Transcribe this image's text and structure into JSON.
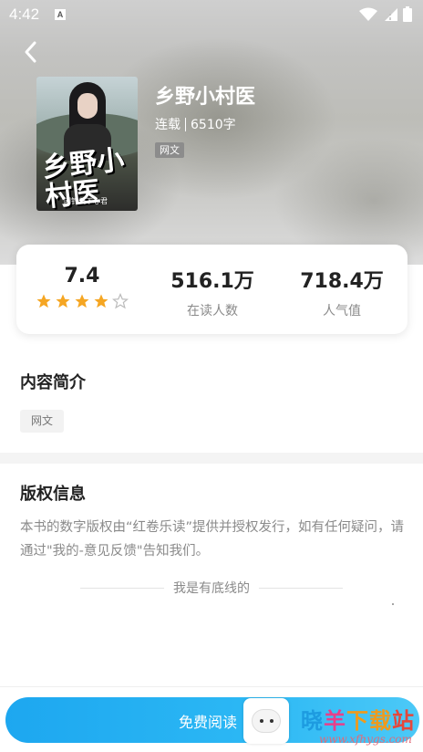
{
  "status_bar": {
    "time": "4:42",
    "notification_badge": "A",
    "icons": [
      "wifi-icon",
      "signal-icon",
      "battery-icon"
    ]
  },
  "header": {
    "back_icon": "chevron-left-icon"
  },
  "book": {
    "cover_title": "乡野小村医",
    "cover_author": "闲钓天下心君",
    "title": "乡野小村医",
    "status": "连载",
    "word_count": "6510字",
    "tag": "网文"
  },
  "stats": {
    "rating": "7.4",
    "rating_stars": 4,
    "rating_max": 5,
    "readers_value": "516.1万",
    "readers_label": "在读人数",
    "popularity_value": "718.4万",
    "popularity_label": "人气值"
  },
  "intro": {
    "title": "内容简介",
    "genre": "网文"
  },
  "copyright": {
    "title": "版权信息",
    "text": "本书的数字版权由“红卷乐读”提供并授权发行，如有任何疑问，请通过\"我的-意见反馈\"告知我们。"
  },
  "footer_note": "我是有底线的",
  "action": {
    "read_label": "免费阅读"
  },
  "watermark": {
    "c1": "晓",
    "c2": "羊",
    "c3": "下载",
    "c4": "站",
    "url": "www.xfhygs.com"
  },
  "colors": {
    "accent": "#1da7f0",
    "star": "#f5a623",
    "muted_text": "#8a8a8a"
  }
}
